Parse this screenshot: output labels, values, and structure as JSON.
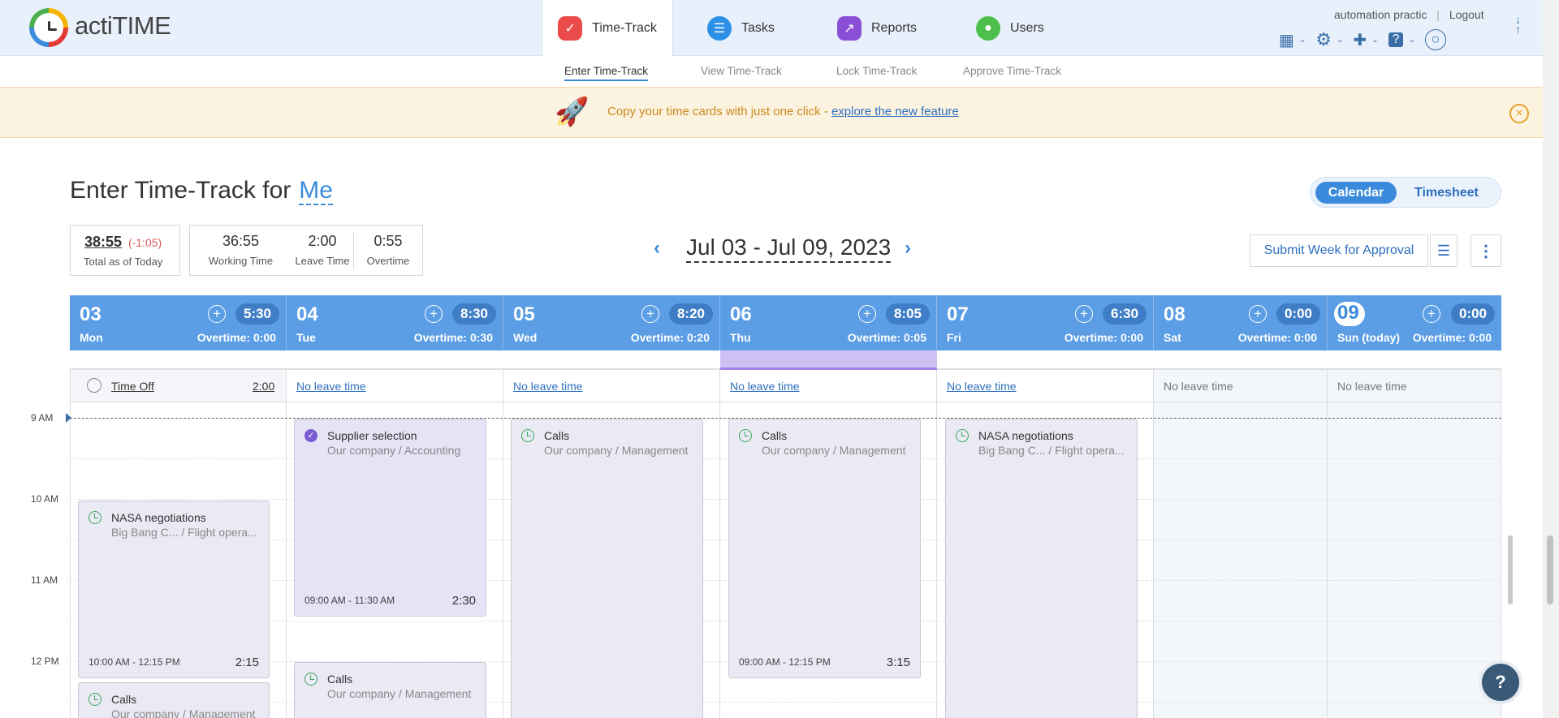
{
  "app": {
    "name": "actiTIME"
  },
  "nav": {
    "tabs": [
      {
        "label": "Time-Track"
      },
      {
        "label": "Tasks"
      },
      {
        "label": "Reports"
      },
      {
        "label": "Users"
      }
    ],
    "subtabs": [
      {
        "label": "Enter Time-Track"
      },
      {
        "label": "View Time-Track"
      },
      {
        "label": "Lock Time-Track"
      },
      {
        "label": "Approve Time-Track"
      }
    ],
    "user": "automation practic",
    "separator": "|",
    "logout": "Logout"
  },
  "banner": {
    "text": "Copy your time cards with just one click - ",
    "link": "explore the new feature",
    "close": "×"
  },
  "page": {
    "title": "Enter Time-Track for",
    "who": "Me",
    "view_calendar": "Calendar",
    "view_timesheet": "Timesheet"
  },
  "summary": {
    "total": "38:55",
    "delta": "(-1:05)",
    "total_label": "Total as of Today",
    "working": "36:55",
    "working_label": "Working Time",
    "leave": "2:00",
    "leave_label": "Leave Time",
    "overtime": "0:55",
    "overtime_label": "Overtime"
  },
  "week": {
    "range": "Jul 03 - Jul 09, 2023",
    "prev": "‹",
    "next": "›",
    "submit": "Submit Week for Approval"
  },
  "days": [
    {
      "num": "03",
      "name": "Mon",
      "total": "5:30",
      "overtime": "Overtime:  0:00",
      "leave": "Time Off",
      "leave_hours": "2:00"
    },
    {
      "num": "04",
      "name": "Tue",
      "total": "8:30",
      "overtime": "Overtime:  0:30",
      "leave": "No leave time"
    },
    {
      "num": "05",
      "name": "Wed",
      "total": "8:20",
      "overtime": "Overtime:  0:20",
      "leave": "No leave time"
    },
    {
      "num": "06",
      "name": "Thu",
      "total": "8:05",
      "overtime": "Overtime:  0:05",
      "leave": "No leave time"
    },
    {
      "num": "07",
      "name": "Fri",
      "total": "6:30",
      "overtime": "Overtime:  0:00",
      "leave": "No leave time"
    },
    {
      "num": "08",
      "name": "Sat",
      "total": "0:00",
      "overtime": "Overtime:  0:00",
      "leave": "No leave time"
    },
    {
      "num": "09",
      "name": "Sun (today)",
      "total": "0:00",
      "overtime": "Overtime:  0:00",
      "leave": "No leave time"
    }
  ],
  "hours": [
    "9 AM",
    "10 AM",
    "11 AM",
    "12 PM"
  ],
  "cards": [
    {
      "title": "NASA negotiations",
      "sub": "Big Bang C...    / Flight opera...",
      "range": "10:00 AM - 12:15 PM",
      "dur": "2:15"
    },
    {
      "title": "Calls",
      "sub": "Our company / Management"
    },
    {
      "title": "Supplier selection",
      "sub": "Our company / Accounting",
      "range": "09:00 AM - 11:30 AM",
      "dur": "2:30"
    },
    {
      "title": "Calls",
      "sub": "Our company / Management"
    },
    {
      "title": "Calls",
      "sub": "Our company / Management"
    },
    {
      "title": "Calls",
      "sub": "Our company / Management",
      "range": "09:00 AM - 12:15 PM",
      "dur": "3:15"
    },
    {
      "title": "NASA negotiations",
      "sub": "Big Bang C...    / Flight opera..."
    }
  ],
  "help": "?",
  "colors": {
    "accent": "#3b8bdc",
    "header": "#5c9ee6",
    "banner": "#fcf2e0",
    "card": "#eaeaf5"
  }
}
